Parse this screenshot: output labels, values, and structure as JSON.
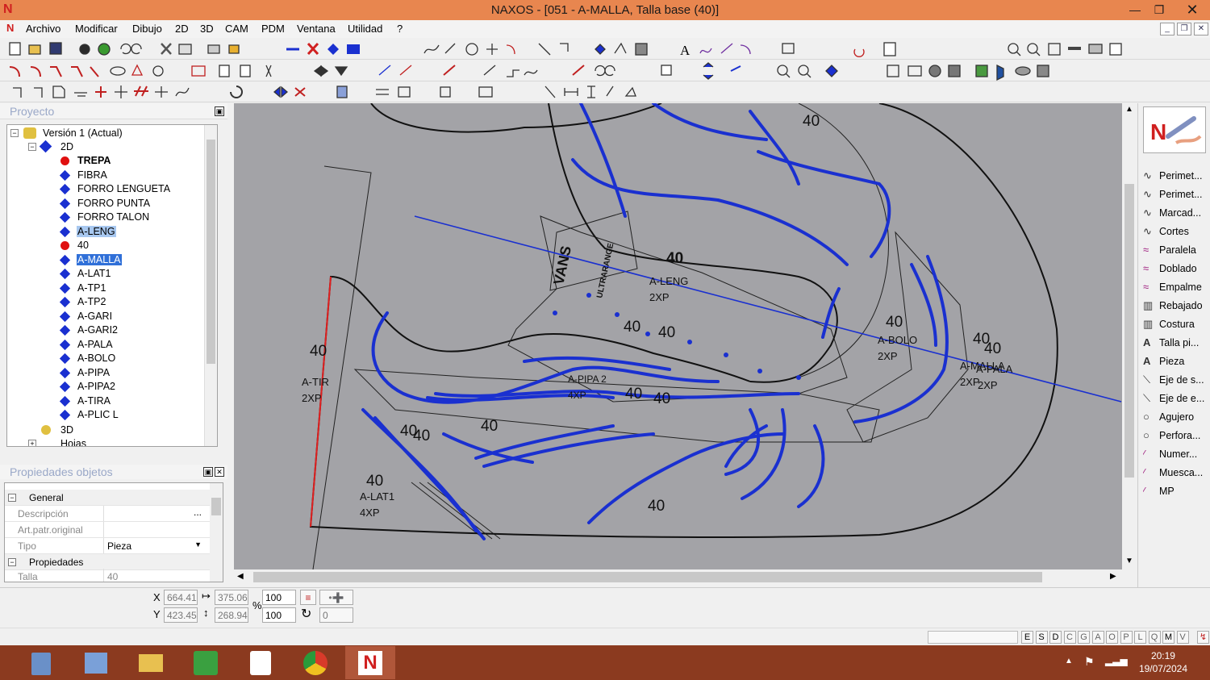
{
  "window": {
    "title": "NAXOS - [051 - A-MALLA, Talla base (40)]",
    "logo": "N"
  },
  "menu": [
    "Archivo",
    "Modificar",
    "Dibujo",
    "2D",
    "3D",
    "CAM",
    "PDM",
    "Ventana",
    "Utilidad",
    "?"
  ],
  "project_panel": {
    "title": "Proyecto"
  },
  "tree": {
    "version": "Versión 1 (Actual)",
    "node_2d": "2D",
    "items": [
      {
        "label": "TREPA",
        "kind": "dot",
        "bold": true
      },
      {
        "label": "FIBRA",
        "kind": "dia"
      },
      {
        "label": "FORRO LENGUETA",
        "kind": "dia"
      },
      {
        "label": "FORRO PUNTA",
        "kind": "dia"
      },
      {
        "label": "FORRO TALON",
        "kind": "dia"
      },
      {
        "label": "A-LENG",
        "kind": "dia",
        "hl": "light"
      },
      {
        "label": "40",
        "kind": "dot"
      },
      {
        "label": "A-MALLA",
        "kind": "dia",
        "hl": "sel"
      },
      {
        "label": "A-LAT1",
        "kind": "dia"
      },
      {
        "label": "A-TP1",
        "kind": "dia"
      },
      {
        "label": "A-TP2",
        "kind": "dia"
      },
      {
        "label": "A-GARI",
        "kind": "dia"
      },
      {
        "label": "A-GARI2",
        "kind": "dia"
      },
      {
        "label": "A-PALA",
        "kind": "dia"
      },
      {
        "label": "A-BOLO",
        "kind": "dia"
      },
      {
        "label": "A-PIPA",
        "kind": "dia"
      },
      {
        "label": "A-PIPA2",
        "kind": "dia"
      },
      {
        "label": "A-TIRA",
        "kind": "dia"
      },
      {
        "label": "A-PLIC L",
        "kind": "dia"
      }
    ],
    "node_3d": "3D",
    "node_hojas": "Hojas"
  },
  "props_panel": {
    "title": "Propiedades objetos",
    "general": "General",
    "descripcion": "Descripción",
    "artpatr": "Art.patr.original",
    "tipo": "Tipo",
    "tipo_value": "Pieza",
    "propiedades": "Propiedades",
    "talla": "Talla",
    "talla_value": "40"
  },
  "canvas_labels": {
    "n40": "40",
    "aleng": "A-LENG",
    "xp2": "2XP",
    "xp4": "4XP",
    "abolo": "A-BOLO",
    "alat1": "A-LAT1",
    "atira": "A-TIR",
    "apipa2": "A-PIPA 2",
    "amalla": "A-MALLA",
    "apala": "A-PALA",
    "logo_text": "VANS",
    "logo_sub": "ULTRARANGE"
  },
  "right_panel": [
    {
      "label": "Perimet...",
      "icon": "curve"
    },
    {
      "label": "Perimet...",
      "icon": "curve"
    },
    {
      "label": "Marcad...",
      "icon": "curve"
    },
    {
      "label": "Cortes",
      "icon": "curve"
    },
    {
      "label": "Paralela",
      "icon": "double-curve"
    },
    {
      "label": "Doblado",
      "icon": "double-curve"
    },
    {
      "label": "Empalme",
      "icon": "double-curve"
    },
    {
      "label": "Rebajado",
      "icon": "hatch"
    },
    {
      "label": "Costura",
      "icon": "hatch"
    },
    {
      "label": "Talla pi...",
      "icon": "letter-a"
    },
    {
      "label": "Pieza",
      "icon": "letter-a"
    },
    {
      "label": "Eje de s...",
      "icon": "diagonal"
    },
    {
      "label": "Eje de e...",
      "icon": "diagonal"
    },
    {
      "label": "Agujero",
      "icon": "circle"
    },
    {
      "label": "Perfora...",
      "icon": "circle"
    },
    {
      "label": "Numer...",
      "icon": "pen"
    },
    {
      "label": "Muesca...",
      "icon": "pen"
    },
    {
      "label": "MP",
      "icon": "pen"
    }
  ],
  "coords": {
    "x_label": "X",
    "y_label": "Y",
    "x": "664.41",
    "y": "423.45",
    "w": "375.06",
    "h": "268.94",
    "sx": "100",
    "sy": "100",
    "pct": "%",
    "angle": "0"
  },
  "status_keys": [
    "E",
    "S",
    "D",
    "C",
    "G",
    "A",
    "O",
    "P",
    "L",
    "Q",
    "M",
    "V"
  ],
  "clock": {
    "time": "20:19",
    "date": "19/07/2024"
  }
}
